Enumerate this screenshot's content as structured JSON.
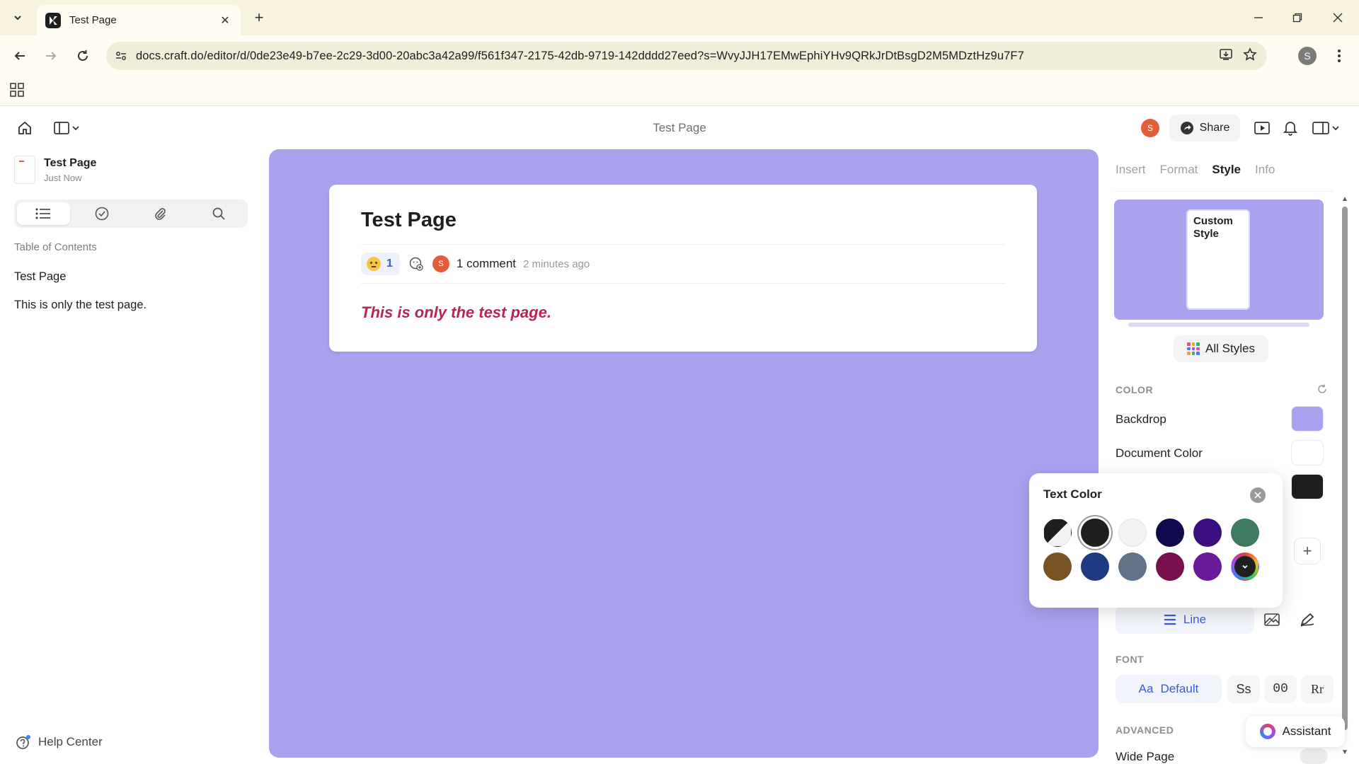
{
  "browser": {
    "tab_title": "Test Page",
    "url": "docs.craft.do/editor/d/0de23e49-b7ee-2c29-3d00-20abc3a42a99/f561f347-2175-42db-9719-142dddd27eed?s=WvyJJH17EMwEphiYHv9QRkJrDtBsgD2M5MDztHz9u7F7",
    "profile_initial": "S"
  },
  "header": {
    "title": "Test Page",
    "avatar_initial": "S",
    "share_label": "Share"
  },
  "sidebar": {
    "doc_name": "Test Page",
    "doc_time": "Just Now",
    "toc_label": "Table of Contents",
    "toc_items": [
      "Test Page",
      "This is only the test page."
    ],
    "help_label": "Help Center"
  },
  "document": {
    "title": "Test Page",
    "reaction_count": "1",
    "avatar_initial": "S",
    "comment_count": "1 comment",
    "comment_time": "2 minutes ago",
    "body": "This is only the test page."
  },
  "inspector": {
    "tabs": [
      "Insert",
      "Format",
      "Style",
      "Info"
    ],
    "active_tab": "Style",
    "style_card_label": "Custom Style",
    "all_styles_label": "All Styles",
    "color_section": "COLOR",
    "backdrop_label": "Backdrop",
    "document_color_label": "Document Color",
    "line_label": "Line",
    "font_section": "FONT",
    "font_default": "Default",
    "font_default_prefix": "Aa",
    "font_options": [
      "Ss",
      "00",
      "Rr"
    ],
    "advanced_section": "ADVANCED",
    "wide_page_label": "Wide Page",
    "assistant_label": "Assistant"
  },
  "colors": {
    "backdrop": "#a9a3ef",
    "document": "#ffffff",
    "text": "#1f1f1f",
    "accent": "#3b5ad6",
    "body_text": "#b8254f"
  },
  "text_color_popover": {
    "title": "Text Color",
    "swatches_row1": [
      "auto",
      "#1f1f1f",
      "#f2f2f2",
      "#0f0a4d",
      "#3a0f80",
      "#3f7a62"
    ],
    "swatches_row2": [
      "#7a5325",
      "#1f3a82",
      "#627487",
      "#7a0f4d",
      "#6a1a9a",
      "more"
    ],
    "selected_index": 1
  }
}
